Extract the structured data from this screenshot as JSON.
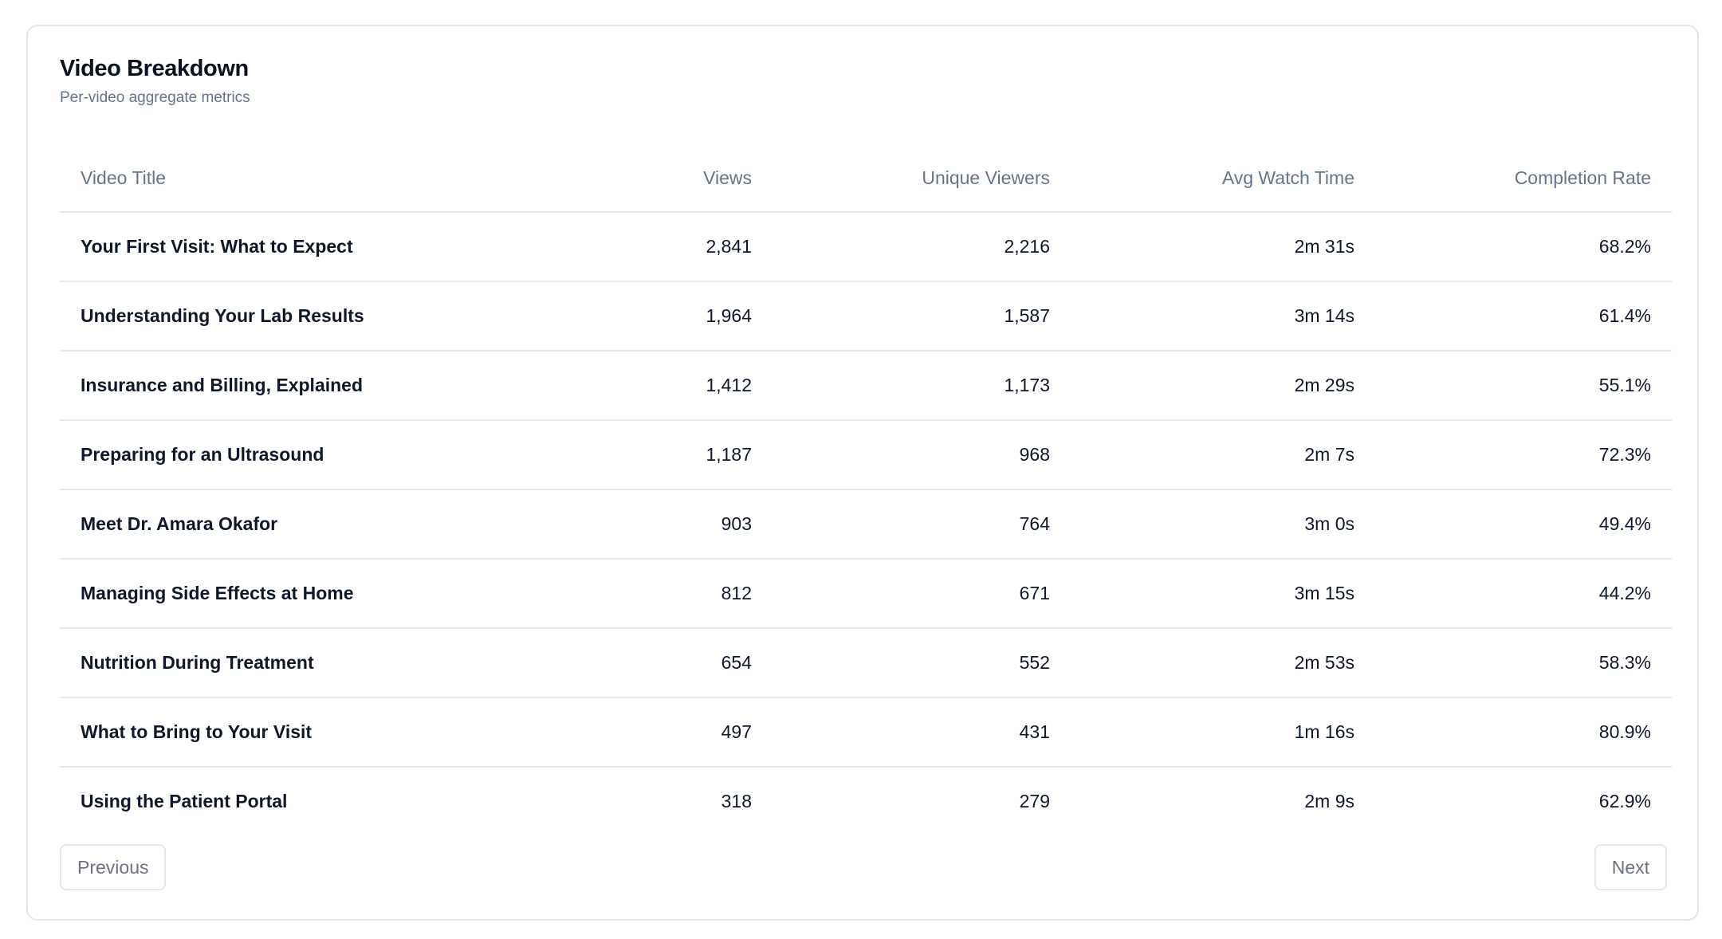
{
  "card": {
    "title": "Video Breakdown",
    "subtitle": "Per-video aggregate metrics"
  },
  "table": {
    "columns": [
      "Video Title",
      "Views",
      "Unique Viewers",
      "Avg Watch Time",
      "Completion Rate"
    ],
    "rows": [
      [
        "Your First Visit: What to Expect",
        "2,841",
        "2,216",
        "2m 31s",
        "68.2%"
      ],
      [
        "Understanding Your Lab Results",
        "1,964",
        "1,587",
        "3m 14s",
        "61.4%"
      ],
      [
        "Insurance and Billing, Explained",
        "1,412",
        "1,173",
        "2m 29s",
        "55.1%"
      ],
      [
        "Preparing for an Ultrasound",
        "1,187",
        "968",
        "2m 7s",
        "72.3%"
      ],
      [
        "Meet Dr. Amara Okafor",
        "903",
        "764",
        "3m 0s",
        "49.4%"
      ],
      [
        "Managing Side Effects at Home",
        "812",
        "671",
        "3m 15s",
        "44.2%"
      ],
      [
        "Nutrition During Treatment",
        "654",
        "552",
        "2m 53s",
        "58.3%"
      ],
      [
        "What to Bring to Your Visit",
        "497",
        "431",
        "1m 16s",
        "80.9%"
      ],
      [
        "Using the Patient Portal",
        "318",
        "279",
        "2m 9s",
        "62.9%"
      ]
    ]
  },
  "pagination": {
    "previous_label": "Previous",
    "next_label": "Next"
  }
}
